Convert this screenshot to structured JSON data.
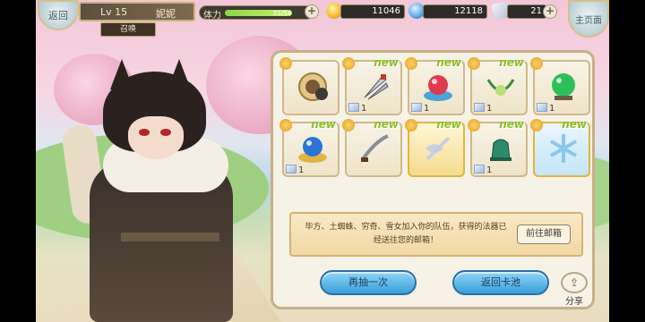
{
  "hud": {
    "back_label": "返回",
    "level": "Lv 15",
    "player_name": "妮妮",
    "mode_label": "召唤",
    "stamina_label": "体力",
    "stamina_value": "51/54",
    "stamina_fraction": 0.94,
    "gold": "11046",
    "gems": "12118",
    "tickets": "21",
    "main_page_label": "主页面"
  },
  "rewards": {
    "items": [
      {
        "icon": "compass-emblem-icon",
        "new": "",
        "count": ""
      },
      {
        "icon": "twin-daggers-icon",
        "new": "new",
        "count": "1"
      },
      {
        "icon": "red-orb-icon",
        "new": "new",
        "count": "1"
      },
      {
        "icon": "wind-charm-icon",
        "new": "new",
        "count": "1"
      },
      {
        "icon": "green-orb-icon",
        "new": "",
        "count": "1"
      },
      {
        "icon": "blue-orb-icon",
        "new": "new",
        "count": "1"
      },
      {
        "icon": "curved-blade-icon",
        "new": "new",
        "count": ""
      },
      {
        "icon": "winged-sword-icon",
        "new": "new",
        "count": ""
      },
      {
        "icon": "green-bell-icon",
        "new": "new",
        "count": "1"
      },
      {
        "icon": "ice-crystal-icon",
        "new": "new",
        "count": ""
      }
    ],
    "message": "毕方、土蜘蛛、穷奇、雪女加入你的队伍，获得的法器已经送往您的邮箱！",
    "mail_button": "前往邮箱",
    "again_button": "再抽一次",
    "return_button": "返回卡池",
    "share_label": "分享"
  },
  "colors": {
    "accent": "#3b9fd9",
    "panel": "#f7f2e6",
    "gold_border": "#c7b088",
    "new_tag": "#8bbf2b"
  }
}
